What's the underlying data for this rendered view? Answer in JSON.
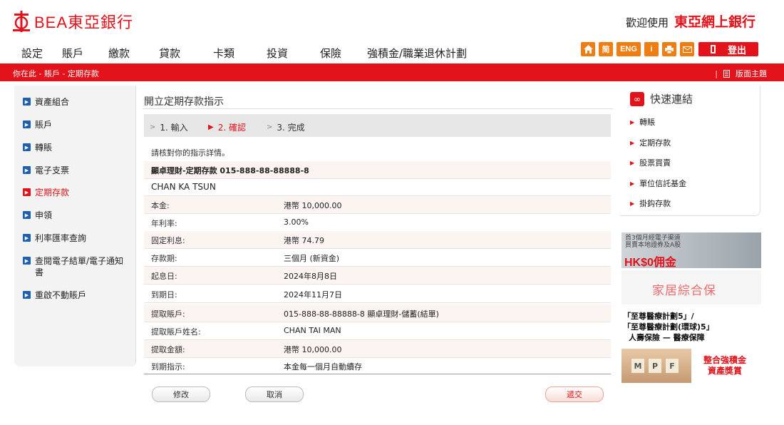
{
  "header": {
    "logo_text": "BEA東亞銀行",
    "welcome_prefix": "歡迎使用",
    "welcome_brand": "東亞網上銀行"
  },
  "nav": [
    "設定",
    "賬戶",
    "繳款",
    "貸款",
    "卡類",
    "投資",
    "保險",
    "強積金/職業退休計劃"
  ],
  "tools": {
    "simplified": "简",
    "english": "ENG",
    "info": "i",
    "logout": "登出"
  },
  "breadcrumb": "你在此 - 賬戶 - 定期存款",
  "topics": "版面主題",
  "sidebar": {
    "items": [
      {
        "label": "資產組合"
      },
      {
        "label": "賬戶"
      },
      {
        "label": "轉賬"
      },
      {
        "label": "電子支票"
      },
      {
        "label": "定期存款"
      },
      {
        "label": "申領"
      },
      {
        "label": "利率匯率查詢"
      },
      {
        "label": "查閱電子結單/電子通知書"
      },
      {
        "label": "重啟不動賬戶"
      }
    ]
  },
  "main": {
    "title": "開立定期存款指示",
    "steps": [
      "1. 輸入",
      "2. 確認",
      "3. 完成"
    ],
    "intro": "請核對你的指示詳情。",
    "account_line": "顯卓理財-定期存款  015-888-88-88888-8",
    "account_name": "CHAN KA TSUN",
    "details": [
      {
        "label": "本金:",
        "value": "港幣 10,000.00"
      },
      {
        "label": "年利率:",
        "value": "3.00%"
      },
      {
        "label": "固定利息:",
        "value": "港幣 74.79"
      },
      {
        "label": "存款期:",
        "value": "三個月 (新資金)"
      },
      {
        "label": "起息日:",
        "value": "2024年8月8日"
      },
      {
        "label": "到期日:",
        "value": "2024年11月7日"
      },
      {
        "label": "提取賬戶:",
        "value": "015-888-88-88888-8  顯卓理財-儲蓄(結單)"
      },
      {
        "label": "提取賬戶姓名:",
        "value": "CHAN TAI MAN"
      },
      {
        "label": "提取金額:",
        "value": "港幣  10,000.00"
      },
      {
        "label": "到期指示:",
        "value": "本金每一個月自動續存"
      }
    ],
    "buttons": {
      "modify": "修改",
      "cancel": "取消",
      "submit": "遞交"
    }
  },
  "quick_links": {
    "title": "快速連結",
    "items": [
      "轉賬",
      "定期存款",
      "股票買賣",
      "單位信託基金",
      "掛鈎存款"
    ]
  },
  "ads": {
    "ad1_line1": "首3個月經電子渠道",
    "ad1_line2": "買賣本地證券及A股",
    "ad1_big": "HK$0佣金",
    "ad2": "家居綜合保",
    "ad3_line1": "「至尊醫療計劃5」/",
    "ad3_line2": "「至尊醫療計劃(環球)5」",
    "ad3_line3": "人壽保險 — 醫療保障",
    "ad4_blocks": [
      "M",
      "P",
      "F"
    ],
    "ad4_line1": "整合強積金",
    "ad4_line2": "資產獎賞"
  }
}
